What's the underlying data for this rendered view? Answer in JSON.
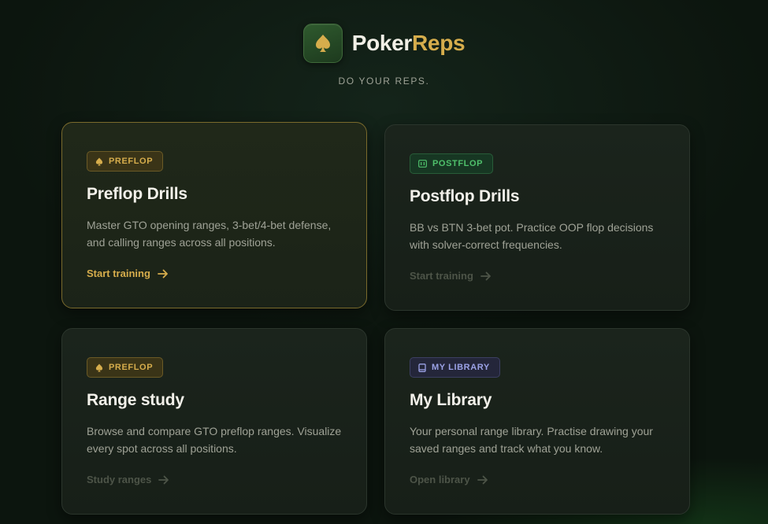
{
  "brand": {
    "name_part1": "Poker",
    "name_part2": "Reps",
    "tagline": "DO YOUR REPS.",
    "logo_icon": "spade-icon"
  },
  "colors": {
    "background": "#0c150e",
    "accent_gold": "#d6ad4c",
    "accent_green": "#4fc06b",
    "accent_purple": "#9ba2e6",
    "card_bg": "#1b241c"
  },
  "cards": [
    {
      "badge": "PREFLOP",
      "badge_icon": "spade-icon",
      "title": "Preflop Drills",
      "description": "Master GTO opening ranges, 3-bet/4-bet defense, and calling ranges across all positions.",
      "cta": "Start training",
      "cta_icon": "arrow-right-icon"
    },
    {
      "badge": "POSTFLOP",
      "badge_icon": "cards-icon",
      "title": "Postflop Drills",
      "description": "BB vs BTN 3-bet pot. Practice OOP flop decisions with solver-correct frequencies.",
      "cta": "Start training",
      "cta_icon": "arrow-right-icon"
    },
    {
      "badge": "PREFLOP",
      "badge_icon": "spade-icon",
      "title": "Range study",
      "description": "Browse and compare GTO preflop ranges. Visualize every spot across all positions.",
      "cta": "Study ranges",
      "cta_icon": "arrow-right-icon"
    },
    {
      "badge": "MY LIBRARY",
      "badge_icon": "book-icon",
      "title": "My Library",
      "description": "Your personal range library. Practise drawing your saved ranges and track what you know.",
      "cta": "Open library",
      "cta_icon": "arrow-right-icon"
    }
  ]
}
